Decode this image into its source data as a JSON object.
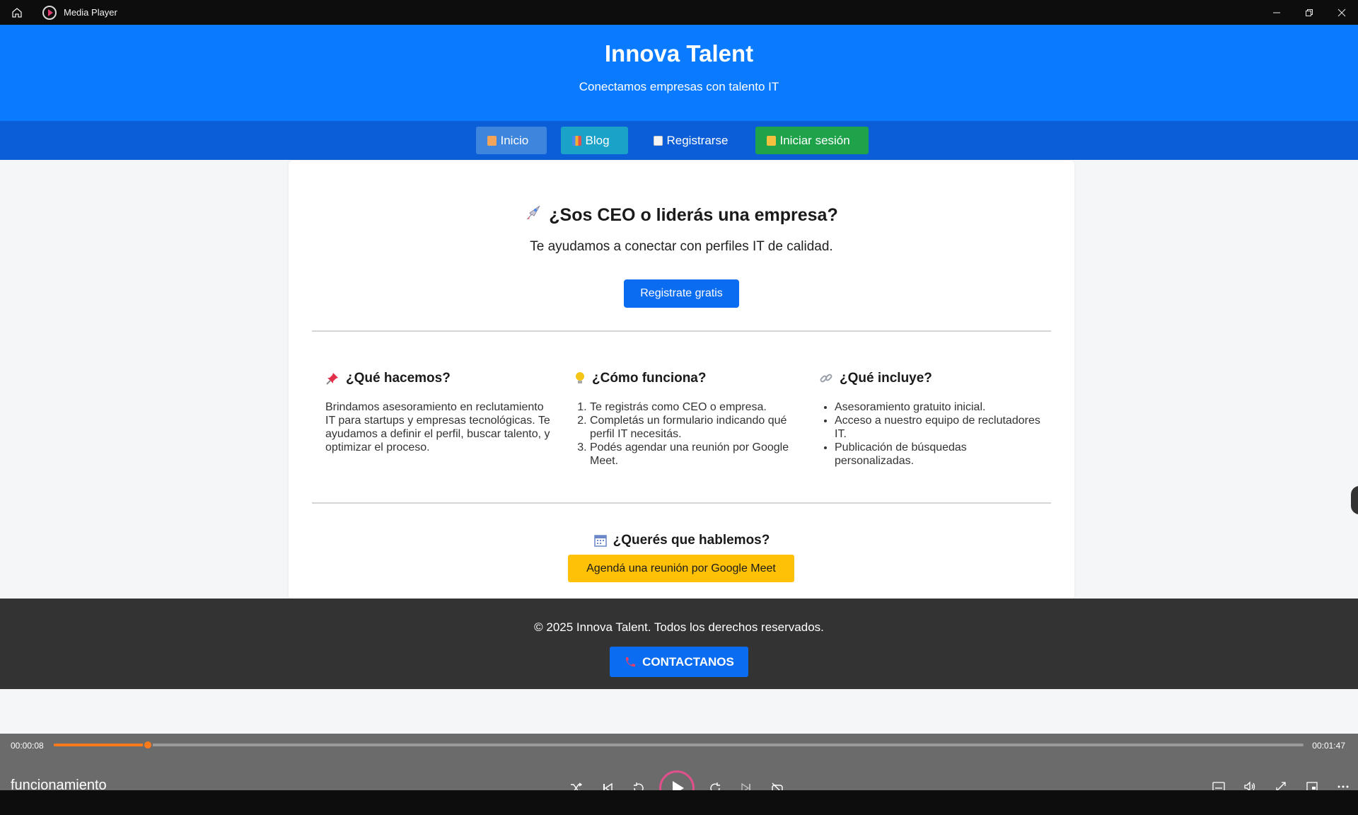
{
  "window": {
    "title": "Media Player"
  },
  "site": {
    "name": "Innova Talent",
    "tagline": "Conectamos empresas con talento IT",
    "nav": [
      {
        "label": "Inicio"
      },
      {
        "label": "Blog"
      },
      {
        "label": "Registrarse"
      },
      {
        "label": "Iniciar sesión"
      }
    ],
    "hero": {
      "title": "¿Sos CEO o liderás una empresa?",
      "subtitle": "Te ayudamos a conectar con perfiles IT de calidad.",
      "cta": "Registrate gratis"
    },
    "sections": {
      "what": {
        "title": "¿Qué hacemos?",
        "text": "Brindamos asesoramiento en reclutamiento IT para startups y empresas tecnológicas. Te ayudamos a definir el perfil, buscar talento, y optimizar el proceso."
      },
      "how": {
        "title": "¿Cómo funciona?",
        "steps": [
          "Te registrás como CEO o empresa.",
          "Completás un formulario indicando qué perfil IT necesitás.",
          "Podés agendar una reunión por Google Meet."
        ]
      },
      "includes": {
        "title": "¿Qué incluye?",
        "items": [
          "Asesoramiento gratuito inicial.",
          "Acceso a nuestro equipo de reclutadores IT.",
          "Publicación de búsquedas personalizadas."
        ]
      }
    },
    "talk": {
      "title": "¿Querés que hablemos?",
      "button": "Agendá una reunión por Google Meet"
    },
    "footer": {
      "copyright": "© 2025 Innova Talent. Todos los derechos reservados.",
      "contact": "CONTACTANOS"
    }
  },
  "player": {
    "current_time": "00:00:08",
    "duration": "00:01:47",
    "progress": 0.075,
    "track_title": "funcionamiento"
  },
  "colors": {
    "header_blue": "#0a7bff",
    "nav_blue": "#0b5ed7",
    "login_green": "#1fa34a",
    "blog_teal": "#1aa2c9",
    "meet_yellow": "#ffc107",
    "footer_dark": "#333333",
    "seek_orange": "#ff7a1a"
  }
}
